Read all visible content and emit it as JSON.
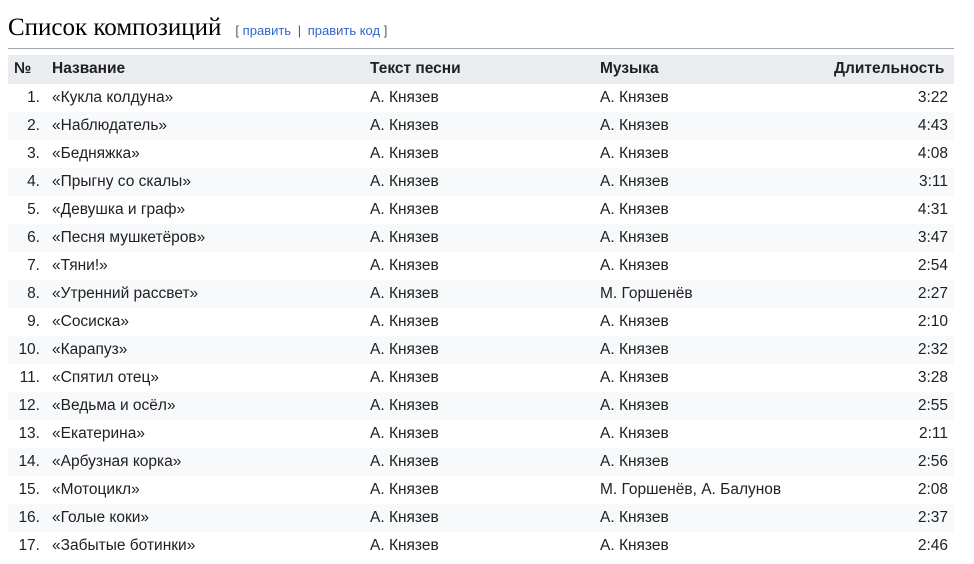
{
  "section": {
    "title": "Список композиций",
    "edit_open": "[",
    "edit_label": "править",
    "edit_sep": "|",
    "edit_code_label": "править код",
    "edit_close": "]"
  },
  "table": {
    "headers": {
      "num": "№",
      "title": "Название",
      "lyrics": "Текст песни",
      "music": "Музыка",
      "duration": "Длительность"
    },
    "rows": [
      {
        "num": "1.",
        "title": "«Кукла колдуна»",
        "lyrics": "А. Князев",
        "music": "А. Князев",
        "duration": "3:22"
      },
      {
        "num": "2.",
        "title": "«Наблюдатель»",
        "lyrics": "А. Князев",
        "music": "А. Князев",
        "duration": "4:43"
      },
      {
        "num": "3.",
        "title": "«Бедняжка»",
        "lyrics": "А. Князев",
        "music": "А. Князев",
        "duration": "4:08"
      },
      {
        "num": "4.",
        "title": "«Прыгну со скалы»",
        "lyrics": "А. Князев",
        "music": "А. Князев",
        "duration": "3:11"
      },
      {
        "num": "5.",
        "title": "«Девушка и граф»",
        "lyrics": "А. Князев",
        "music": "А. Князев",
        "duration": "4:31"
      },
      {
        "num": "6.",
        "title": "«Песня мушкетёров»",
        "lyrics": "А. Князев",
        "music": "А. Князев",
        "duration": "3:47"
      },
      {
        "num": "7.",
        "title": "«Тяни!»",
        "lyrics": "А. Князев",
        "music": "А. Князев",
        "duration": "2:54"
      },
      {
        "num": "8.",
        "title": "«Утренний рассвет»",
        "lyrics": "А. Князев",
        "music": "М. Горшенёв",
        "duration": "2:27"
      },
      {
        "num": "9.",
        "title": "«Сосиска»",
        "lyrics": "А. Князев",
        "music": "А. Князев",
        "duration": "2:10"
      },
      {
        "num": "10.",
        "title": "«Карапуз»",
        "lyrics": "А. Князев",
        "music": "А. Князев",
        "duration": "2:32"
      },
      {
        "num": "11.",
        "title": "«Спятил отец»",
        "lyrics": "А. Князев",
        "music": "А. Князев",
        "duration": "3:28"
      },
      {
        "num": "12.",
        "title": "«Ведьма и осёл»",
        "lyrics": "А. Князев",
        "music": "А. Князев",
        "duration": "2:55"
      },
      {
        "num": "13.",
        "title": "«Екатерина»",
        "lyrics": "А. Князев",
        "music": "А. Князев",
        "duration": "2:11"
      },
      {
        "num": "14.",
        "title": "«Арбузная корка»",
        "lyrics": "А. Князев",
        "music": "А. Князев",
        "duration": "2:56"
      },
      {
        "num": "15.",
        "title": "«Мотоцикл»",
        "lyrics": "А. Князев",
        "music": "М. Горшенёв, А. Балунов",
        "duration": "2:08"
      },
      {
        "num": "16.",
        "title": "«Голые коки»",
        "lyrics": "А. Князев",
        "music": "А. Князев",
        "duration": "2:37"
      },
      {
        "num": "17.",
        "title": "«Забытые ботинки»",
        "lyrics": "А. Князев",
        "music": "А. Князев",
        "duration": "2:46"
      }
    ]
  },
  "colors": {
    "link": "#3366cc",
    "header_bg": "#eaecf0",
    "row_stripe": "#f8f9fa",
    "text": "#202122"
  }
}
